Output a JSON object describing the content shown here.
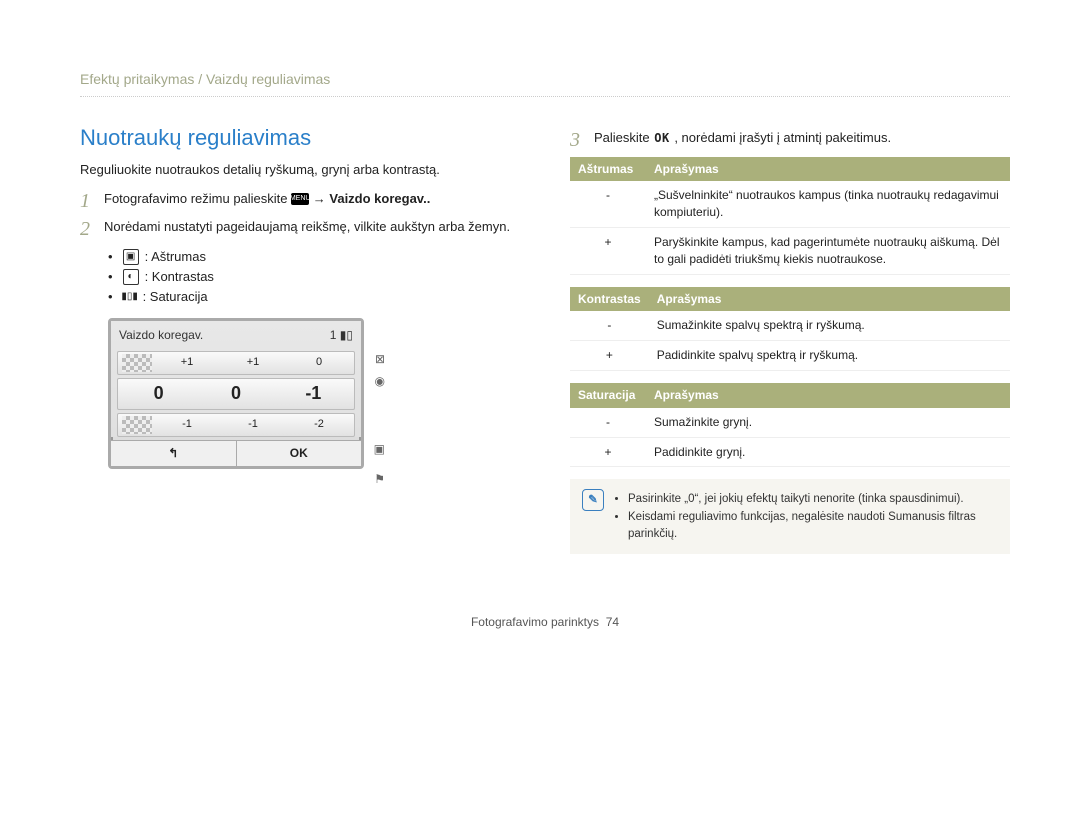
{
  "breadcrumb": "Efektų pritaikymas / Vaizdų reguliavimas",
  "title": "Nuotraukų reguliavimas",
  "intro": "Reguliuokite nuotraukos detalių ryškumą, grynį arba kontrastą.",
  "steps": {
    "s1_prefix": "Fotografavimo režimu palieskite ",
    "s1_menu": "MENU",
    "s1_arrow": " → ",
    "s1_suffix": "Vaizdo koregav..",
    "s2": "Norėdami nustatyti pageidaujamą reikšmę, vilkite aukštyn arba žemyn.",
    "s3_prefix": "Palieskite ",
    "s3_ok": "OK",
    "s3_suffix": ", norėdami įrašyti į atmintį pakeitimus."
  },
  "bullets": {
    "sharpness": ": Aštrumas",
    "contrast": ": Kontrastas",
    "saturation": ": Saturacija"
  },
  "lcd": {
    "title": "Vaizdo koregav.",
    "count": "1",
    "row1": [
      "+1",
      "+1",
      "0"
    ],
    "row_mid": [
      "0",
      "0",
      "-1"
    ],
    "row3": [
      "-1",
      "-1",
      "-2"
    ],
    "btn_back": "↰",
    "btn_ok": "OK"
  },
  "tables": {
    "sharpness": {
      "head1": "Aštrumas",
      "head2": "Aprašymas",
      "rows": [
        {
          "k": "-",
          "v": "„Sušvelninkite“ nuotraukos kampus (tinka nuotraukų redagavimui kompiuteriu)."
        },
        {
          "k": "+",
          "v": "Paryškinkite kampus, kad pagerintumėte nuotraukų aiškumą. Dėl to gali padidėti triukšmų kiekis nuotraukose."
        }
      ]
    },
    "contrast": {
      "head1": "Kontrastas",
      "head2": "Aprašymas",
      "rows": [
        {
          "k": "-",
          "v": "Sumažinkite spalvų spektrą ir ryškumą."
        },
        {
          "k": "+",
          "v": "Padidinkite spalvų spektrą ir ryškumą."
        }
      ]
    },
    "saturation": {
      "head1": "Saturacija",
      "head2": "Aprašymas",
      "rows": [
        {
          "k": "-",
          "v": "Sumažinkite grynį."
        },
        {
          "k": "+",
          "v": "Padidinkite grynį."
        }
      ]
    }
  },
  "note": {
    "n1": "Pasirinkite „0“, jei jokių efektų taikyti nenorite (tinka spausdinimui).",
    "n2": "Keisdami reguliavimo funkcijas, negalėsite naudoti Sumanusis filtras parinkčių."
  },
  "footer": {
    "label": "Fotografavimo parinktys",
    "page": "74"
  }
}
